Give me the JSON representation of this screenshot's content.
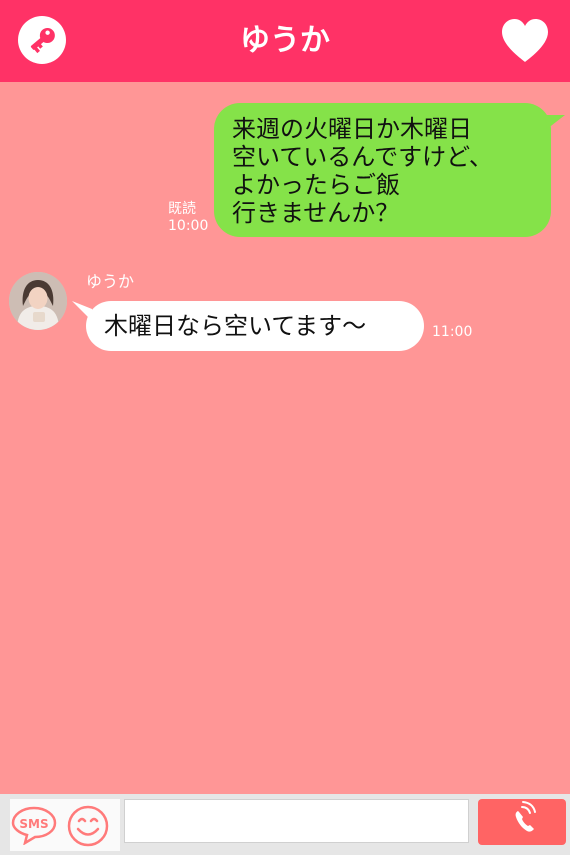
{
  "header": {
    "title": "ゆうか",
    "left_icon": "key-icon",
    "right_icon": "heart-icon"
  },
  "messages": {
    "outgoing": {
      "text": "来週の火曜日か木曜日\n空いているんですけど、\nよかったらご飯\n行きませんか？",
      "read_label": "既読",
      "time": "10:00"
    },
    "incoming": {
      "sender": "ゆうか",
      "text": "木曜日なら空いてます〜",
      "time": "11:00"
    }
  },
  "input_bar": {
    "sms_label": "SMS",
    "emoji_icon": "smile-icon",
    "message_value": "",
    "call_icon": "phone-icon"
  },
  "colors": {
    "header": "#ff3266",
    "background": "#ff9696",
    "outgoing_bubble": "#85e249",
    "incoming_bubble": "#ffffff",
    "call_button": "#ff6464"
  }
}
